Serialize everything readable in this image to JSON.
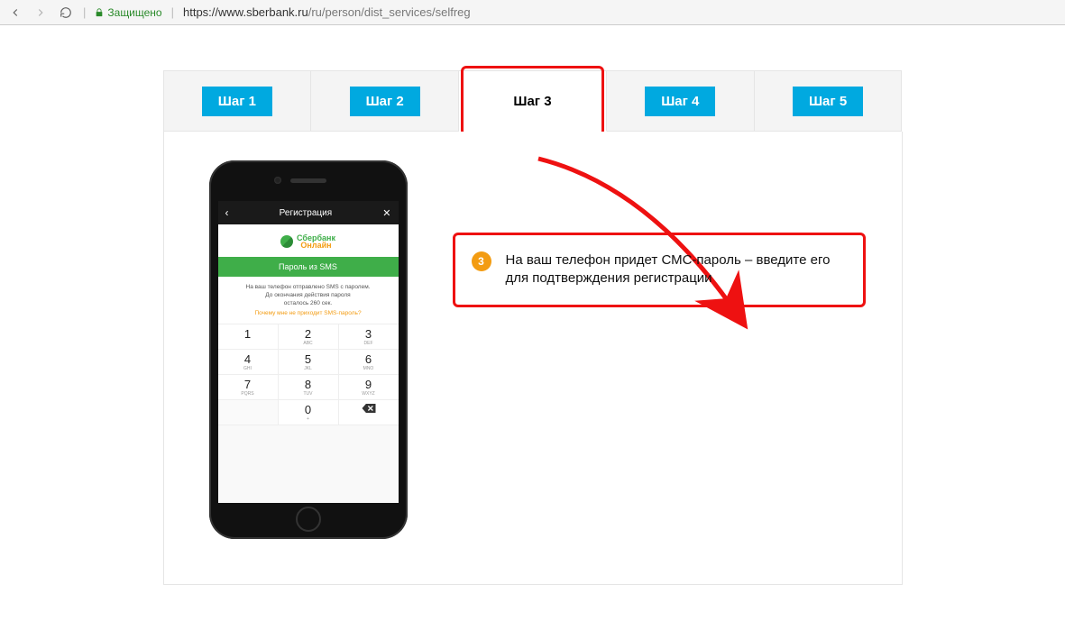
{
  "browser": {
    "secure_label": "Защищено",
    "url_host": "https://www.sberbank.ru",
    "url_path": "/ru/person/dist_services/selfreg"
  },
  "tabs": [
    {
      "label": "Шаг 1",
      "active": false
    },
    {
      "label": "Шаг 2",
      "active": false
    },
    {
      "label": "Шаг 3",
      "active": true
    },
    {
      "label": "Шаг 4",
      "active": false
    },
    {
      "label": "Шаг 5",
      "active": false
    }
  ],
  "phone": {
    "title": "Регистрация",
    "brand_top": "Сбербанк",
    "brand_bottom": "Онлайн",
    "sms_header": "Пароль из SMS",
    "msg_line1": "На ваш телефон отправлено SMS с паролем.",
    "msg_line2a": "До окончания действия пароля",
    "msg_line2b": "осталось 260 сек.",
    "msg_link": "Почему мне не приходит SMS-пароль?",
    "keypad": [
      [
        {
          "d": "1",
          "s": ""
        },
        {
          "d": "2",
          "s": "ABC"
        },
        {
          "d": "3",
          "s": "DEF"
        }
      ],
      [
        {
          "d": "4",
          "s": "GHI"
        },
        {
          "d": "5",
          "s": "JKL"
        },
        {
          "d": "6",
          "s": "MNO"
        }
      ],
      [
        {
          "d": "7",
          "s": "PQRS"
        },
        {
          "d": "8",
          "s": "TUV"
        },
        {
          "d": "9",
          "s": "WXYZ"
        }
      ],
      [
        {
          "d": "",
          "s": ""
        },
        {
          "d": "0",
          "s": "+"
        },
        {
          "d": "⌫",
          "s": "",
          "cls": "del"
        }
      ]
    ]
  },
  "callout": {
    "badge": "3",
    "text": "На ваш телефон придет СМС-пароль – введите его для подтверждения регистрации"
  }
}
